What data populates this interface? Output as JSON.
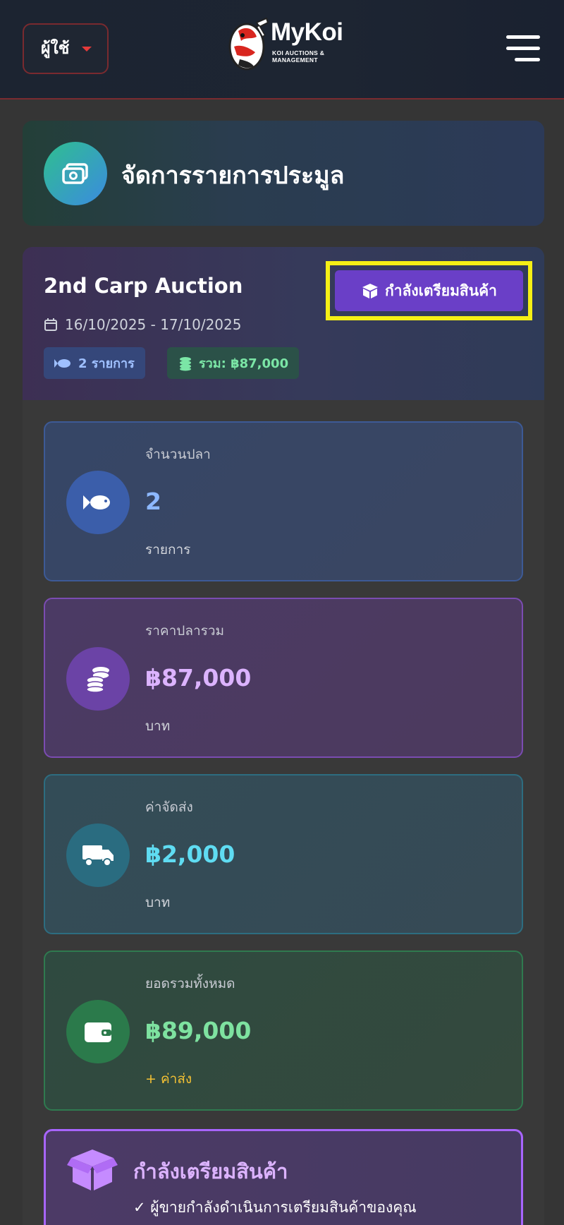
{
  "header": {
    "user_button_label": "ผู้ใช้",
    "logo_title": "MyKoi",
    "logo_subtitle_1": "KOI AUCTIONS &",
    "logo_subtitle_2": "MANAGEMENT"
  },
  "page_title": "จัดการรายการประมูล",
  "auction": {
    "name": "2nd Carp Auction",
    "status_label": "กำลังเตรียมสินค้า",
    "date_range": "16/10/2025 - 17/10/2025",
    "items_chip": "2 รายการ",
    "total_chip": "รวม: ฿87,000"
  },
  "stats": [
    {
      "label": "จำนวนปลา",
      "value": "2",
      "unit": "รายการ",
      "icon": "fish-icon"
    },
    {
      "label": "ราคาปลารวม",
      "value": "฿87,000",
      "unit": "บาท",
      "icon": "coins-icon"
    },
    {
      "label": "ค่าจัดส่ง",
      "value": "฿2,000",
      "unit": "บาท",
      "icon": "truck-icon"
    },
    {
      "label": "ยอดรวมทั้งหมด",
      "value": "฿89,000",
      "unit": "+ ค่าส่ง",
      "icon": "wallet-icon"
    }
  ],
  "preparing": {
    "title": "กำลังเตรียมสินค้า",
    "line": "✓ ผู้ขายกำลังดำเนินการเตรียมสินค้าของคุณ"
  },
  "colors": {
    "accent_purple": "#6a3fc7",
    "highlight_yellow": "#f5ef15",
    "brand_red": "#e63a3a"
  }
}
